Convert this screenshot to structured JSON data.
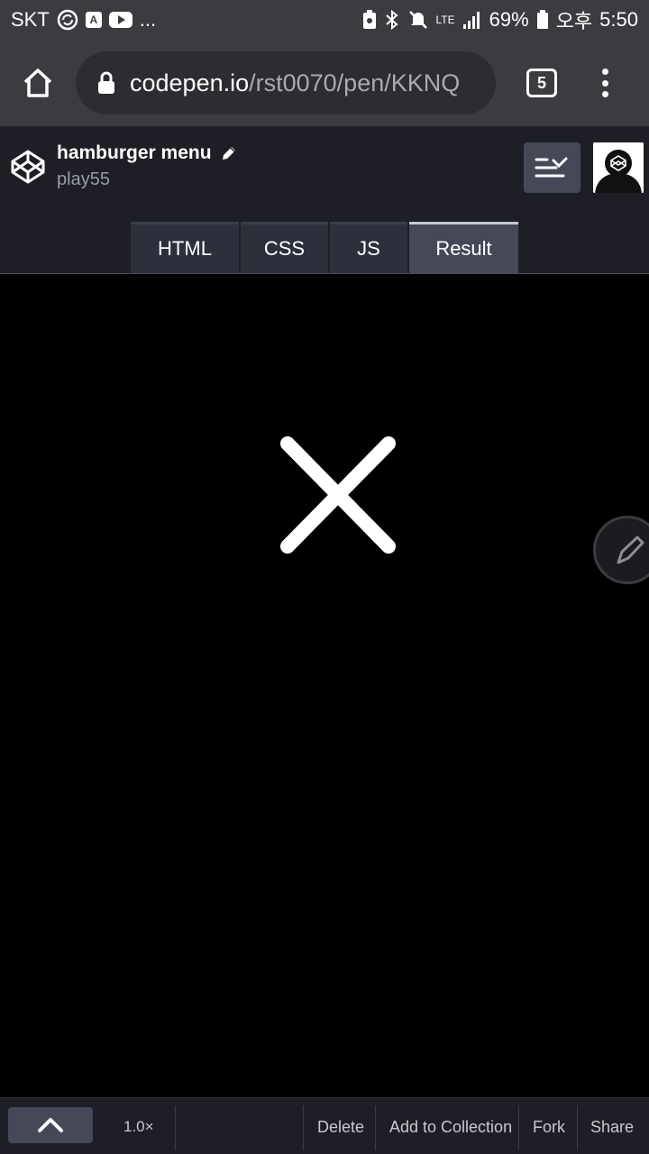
{
  "status_bar": {
    "carrier": "SKT",
    "notification_more": "...",
    "app_icon_letter": "A",
    "network": "LTE",
    "battery": "69%",
    "ampm": "오후",
    "time": "5:50"
  },
  "browser": {
    "url_host": "codepen.io",
    "url_path": "/rst0070/pen/KKNQ",
    "tab_count": "5"
  },
  "codepen": {
    "pen_title": "hamburger menu",
    "author": "play55",
    "tabs": [
      {
        "label": "HTML",
        "active": false
      },
      {
        "label": "CSS",
        "active": false
      },
      {
        "label": "JS",
        "active": false
      },
      {
        "label": "Result",
        "active": true
      }
    ]
  },
  "result": {
    "icon": "close-icon",
    "background": "#000000"
  },
  "bottom_bar": {
    "zoom": "1.0×",
    "delete": "Delete",
    "add_to_collection": "Add to Collection",
    "fork": "Fork",
    "share": "Share"
  },
  "colors": {
    "header_bg": "#1e1f26",
    "tab_bg": "#2c303a",
    "tab_active_bg": "#444857",
    "browser_bg": "#3a3c3f"
  }
}
